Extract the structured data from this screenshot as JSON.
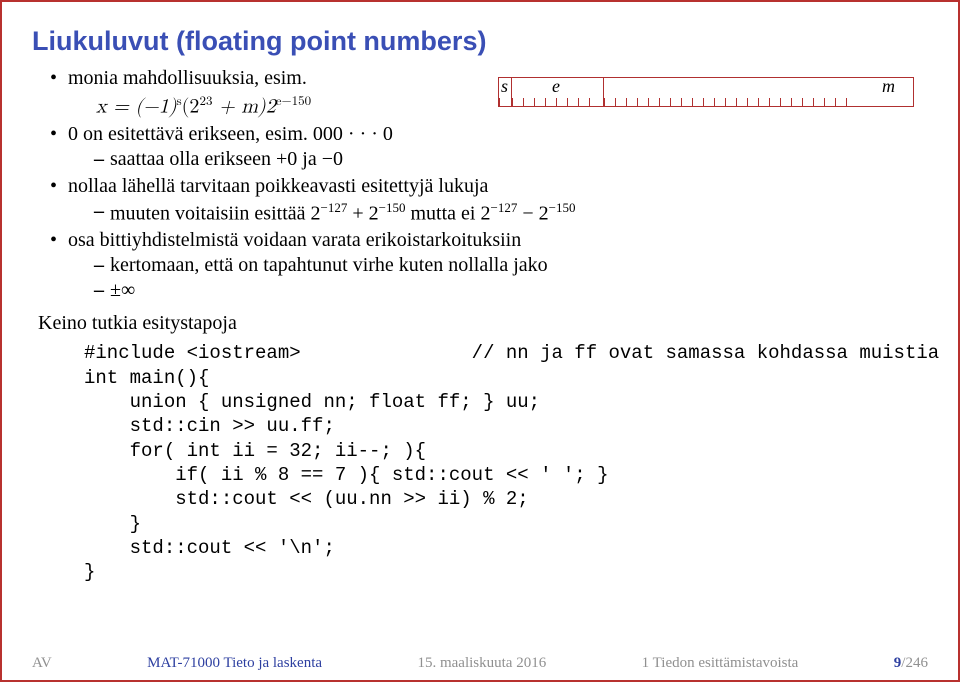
{
  "title": "Liukuluvut (floating point numbers)",
  "bullets": {
    "b1": "monia mahdollisuuksia, esim.",
    "b1_formula_prefix": "x = (−1)",
    "b1_formula_sup1": "s",
    "b1_formula_mid1": "(2",
    "b1_formula_sup2": "23",
    "b1_formula_mid2": " + m)2",
    "b1_formula_sup3": "e−150",
    "b2": "0 on esitettävä erikseen, esim. 000 · · · 0",
    "b2_sub": "saattaa olla erikseen +0 ja −0",
    "b3": "nollaa lähellä tarvitaan poikkeavasti esitettyjä lukuja",
    "b3_sub_pre": "muuten voitaisiin esittää 2",
    "b3_sub_s1": "−127",
    "b3_sub_mid1": " + 2",
    "b3_sub_s2": "−150",
    "b3_sub_mid2": " mutta ei 2",
    "b3_sub_s3": "−127",
    "b3_sub_mid3": " − 2",
    "b3_sub_s4": "−150",
    "b4": "osa bittiyhdistelmistä voidaan varata erikoistarkoituksiin",
    "b4_sub1": "kertomaan, että on tapahtunut virhe kuten nollalla jako",
    "b4_sub2": "±∞"
  },
  "floatbox": {
    "s": "s",
    "e": "e",
    "m": "m"
  },
  "keino": {
    "head": "Keino tutkia esitystapoja",
    "l1a": "#include <iostream>",
    "l1b": "// nn ja ff ovat samassa kohdassa muistia",
    "l2": "int main(){",
    "l3": "    union { unsigned nn; float ff; } uu;",
    "l4": "    std::cin >> uu.ff;",
    "l5": "    for( int ii = 32; ii--; ){",
    "l6": "        if( ii % 8 == 7 ){ std::cout << ' '; }",
    "l7": "        std::cout << (uu.nn >> ii) % 2;",
    "l8": "    }",
    "l9": "    std::cout << '\\n';",
    "l10": "}"
  },
  "footer": {
    "author": "AV",
    "course": "MAT-71000 Tieto ja laskenta",
    "date": "15. maaliskuuta 2016",
    "section": "1 Tiedon esittämistavoista",
    "page_cur": "9",
    "page_sep": "/",
    "page_tot": "246"
  }
}
